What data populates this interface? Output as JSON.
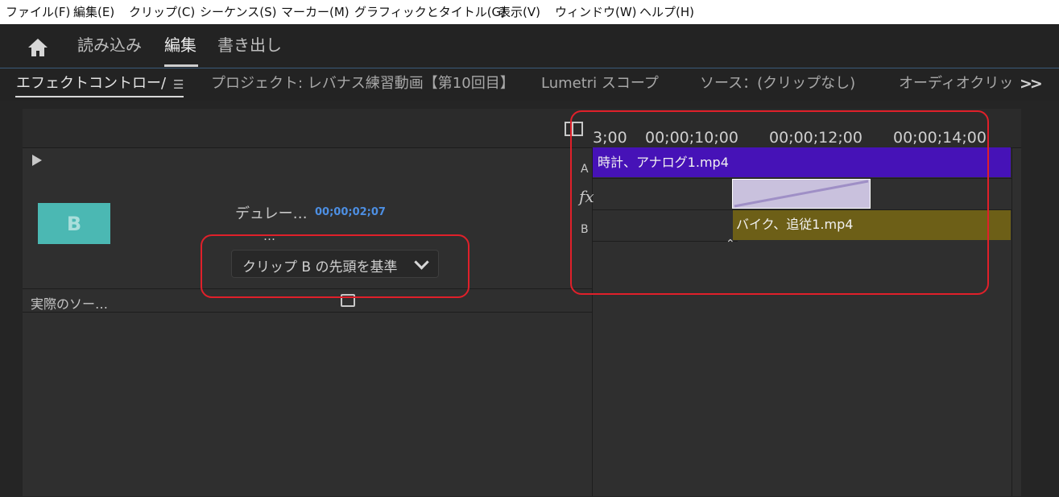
{
  "menu": [
    "ファイル(F)",
    "編集(E)",
    "クリップ(C)",
    "シーケンス(S)",
    "マーカー(M)",
    "グラフィックとタイトル(G)",
    "表示(V)",
    "ウィンドウ(W)",
    "ヘルプ(H)"
  ],
  "workspace_tabs": [
    "読み込み",
    "編集",
    "書き出し"
  ],
  "workspace_active": "編集",
  "panel_tabs": [
    "エフェクトコントロー/",
    "プロジェクト: レバナス練習動画【第10回目】",
    "Lumetri スコープ",
    "ソース：(クリップなし)",
    "オーディオクリッ"
  ],
  "effect_controls": {
    "thumbnail_letter": "B",
    "duration_label": "デュレー…",
    "duration_value": "00;00;02;07",
    "ellipsis": "…",
    "alignment_dropdown": "クリップ B の先頭を基準",
    "source_label": "実際のソー…"
  },
  "timeline": {
    "ruler": [
      "3;00",
      "00;00;10;00",
      "00;00;12;00",
      "00;00;14;00"
    ],
    "track_a_label": "A",
    "track_b_label": "B",
    "fx_label": "fx",
    "clip_a": "時計、アナログ1.mp4",
    "clip_b": "バイク、追従1.mp4"
  },
  "colors": {
    "clip_a": "#4612b7",
    "clip_b": "#6d5f17",
    "transition": "#c9c1dd",
    "thumbnail": "#4bb8b3",
    "duration_value": "#4d8fe3",
    "highlight": "#e0202a"
  }
}
